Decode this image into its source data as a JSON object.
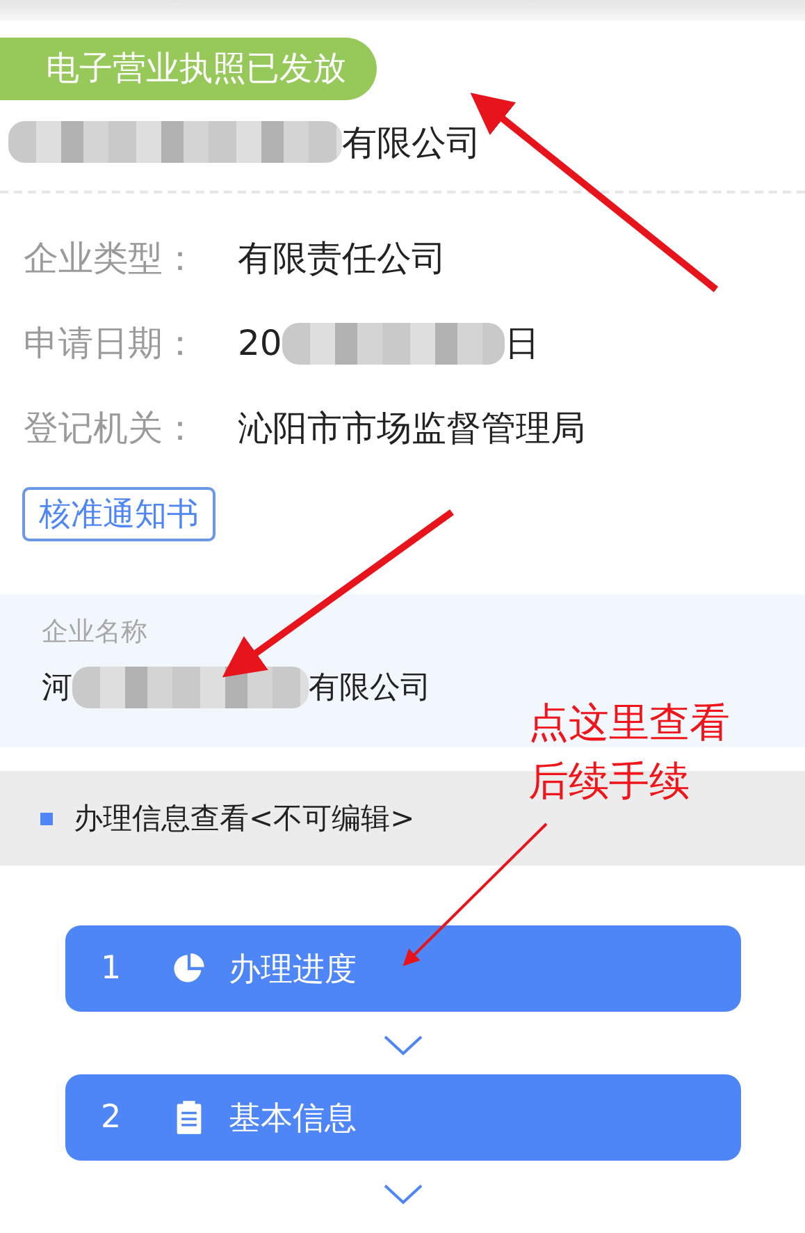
{
  "status_badge": "电子营业执照已发放",
  "company": {
    "suffix": "有限公司"
  },
  "fields": [
    {
      "kind": "plain",
      "label": "企业类型：",
      "value": "有限责任公司"
    },
    {
      "kind": "redacted",
      "label": "申请日期：",
      "value": "20",
      "tail": "日"
    },
    {
      "kind": "plain",
      "label": "登记机关：",
      "value": "沁阳市市场监督管理局"
    }
  ],
  "notice_button": "核准通知书",
  "name_panel": {
    "label": "企业名称",
    "prefix": "河",
    "suffix": "有限公司"
  },
  "section_title": "办理信息查看<不可编辑>",
  "steps": [
    {
      "number": "1",
      "kind": "progress",
      "label": "办理进度"
    },
    {
      "number": "2",
      "kind": "info",
      "label": "基本信息"
    }
  ],
  "annotation": {
    "lines": [
      "点这里查看",
      "后续手续"
    ]
  }
}
